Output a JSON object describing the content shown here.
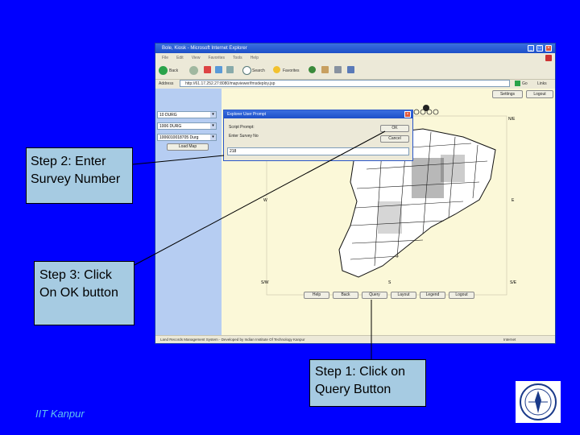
{
  "window": {
    "title": "Bole, Kiosk - Microsoft Internet Explorer",
    "menu": [
      "File",
      "Edit",
      "View",
      "Favorites",
      "Tools",
      "Help"
    ],
    "toolbar": {
      "back": "Back",
      "search": "Search",
      "favorites": "Favorites"
    },
    "address_label": "Address",
    "address_url": "http://61.17.252.27:8080/mapviewer/fmsdeploy.jsp",
    "go_label": "Go",
    "links_label": "Links"
  },
  "app": {
    "settings_label": "Settings",
    "logout_label": "Logout",
    "district_select": "10 DURG",
    "tehsil_select": "1006 DURG",
    "village_select": "1006010018705 Durg",
    "load_map_label": "Load Map",
    "compass": {
      "ne": "N/E",
      "e": "E",
      "w": "W",
      "sw": "S/W",
      "s": "S",
      "se": "S/E"
    },
    "map_buttons": [
      "Help",
      "Back",
      "Query",
      "Layout",
      "Legend",
      "Logout"
    ]
  },
  "dialog": {
    "title": "Explorer User Prompt",
    "script_prompt": "Script Prompt:",
    "question": "Enter Survey No",
    "ok_label": "OK",
    "cancel_label": "Cancel",
    "input_value": "218"
  },
  "status": {
    "left": "Land Records Management System - Developed by Indian Institute Of Technology Kanpur",
    "right": "Internet"
  },
  "callouts": {
    "step2": "Step 2: Enter Survey Number",
    "step3": "Step 3: Click On OK button",
    "step1": "Step 1: Click on Query Button"
  },
  "footer": "IIT Kanpur",
  "colors": {
    "background": "#0000ff",
    "callout": "#a6cbe2",
    "footer_text": "#5fc3f0",
    "map_background": "#fbf8d8"
  }
}
